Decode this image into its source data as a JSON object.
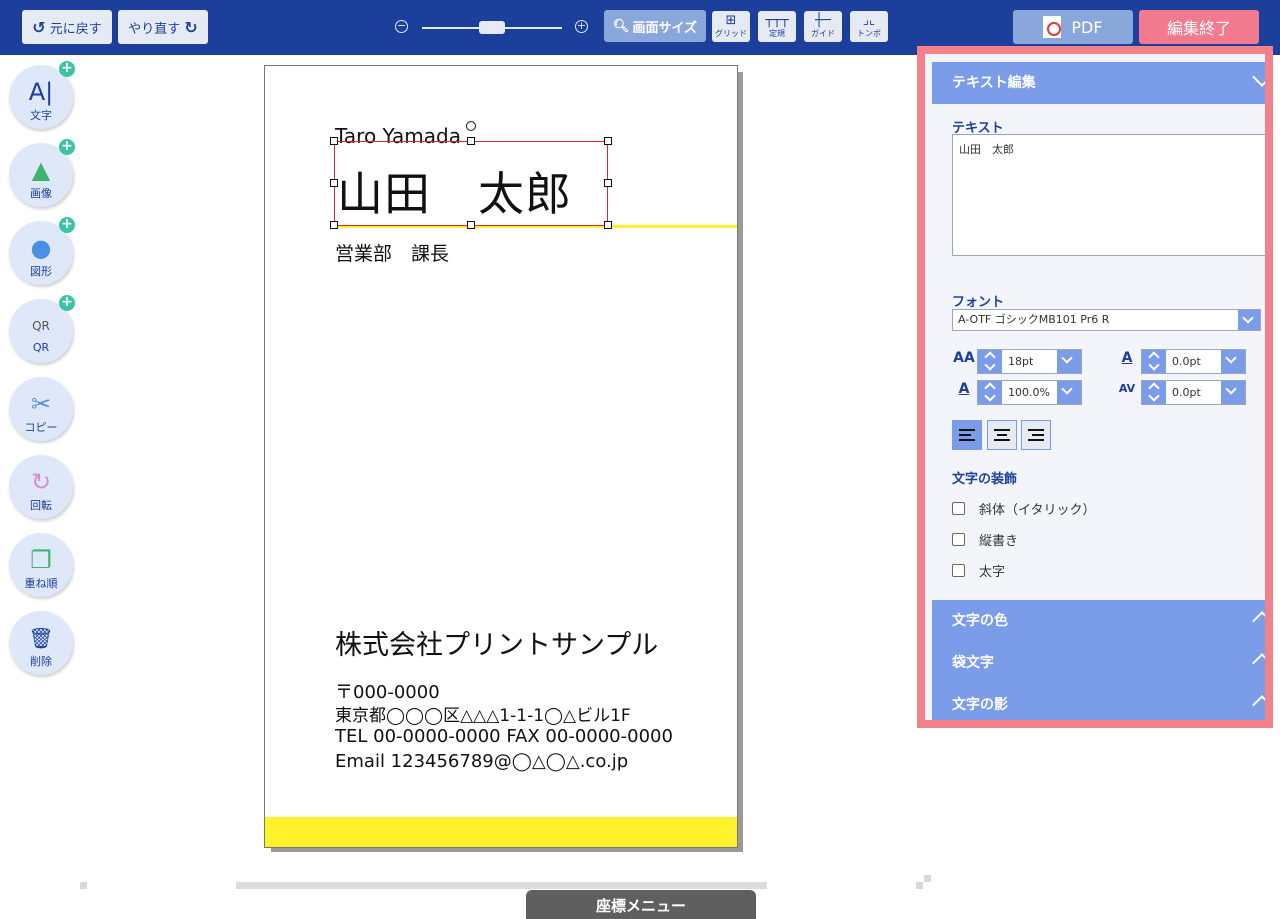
{
  "toolbar": {
    "undo_label": "元に戻す",
    "redo_label": "やり直す",
    "zoom_minus": "−",
    "zoom_plus": "+",
    "zoom_level": 0.5,
    "screen_size_label": "画面サイズ",
    "grid_label": "グリッド",
    "ruler_label": "定規",
    "guide_label": "ガイド",
    "trim_label": "トンボ",
    "pdf_label": "PDF",
    "end_edit_label": "編集終了"
  },
  "left_tools": [
    {
      "glyph": "A|",
      "label": "文字",
      "add": "+"
    },
    {
      "glyph": "▲",
      "label": "画像",
      "add": "+"
    },
    {
      "glyph": "●",
      "label": "図形",
      "add": "+"
    },
    {
      "glyph": "QR",
      "label": "QR",
      "add": "+"
    },
    {
      "glyph": "✂",
      "label": "コピー",
      "add": ""
    },
    {
      "glyph": "↻",
      "label": "回転",
      "add": ""
    },
    {
      "glyph": "❐",
      "label": "重ね順",
      "add": ""
    },
    {
      "glyph": "🗑",
      "label": "削除",
      "add": ""
    }
  ],
  "card": {
    "name_en": "Taro Yamada",
    "name_jp": "山田　太郎",
    "title": "営業部　課長",
    "company": "株式会社プリントサンプル",
    "postal": "〒000-0000",
    "address": "東京都◯◯◯区△△△1-1-1◯△ビル1F",
    "tel_fax": "TEL 00-0000-0000  FAX 00-0000-0000",
    "email": "Email 123456789@◯△◯△.co.jp",
    "accent_color": "#fff22a"
  },
  "coord_menu_label": "座標メニュー",
  "panel": {
    "header": "テキスト編集",
    "text_label": "テキスト",
    "text_value": "山田　太郎",
    "font_label": "フォント",
    "font_value": "A-OTF ゴシックMB101 Pr6 R",
    "font_size_icon": "AA",
    "font_size": "18pt",
    "line_spacing_icon": "A",
    "line_spacing": "0.0pt",
    "width_scale_icon": "A",
    "width_scale": "100.0%",
    "letter_spacing_icon": "AV",
    "letter_spacing": "0.0pt",
    "decoration_label": "文字の装飾",
    "italic_label": "斜体（イタリック）",
    "vertical_label": "縦書き",
    "bold_label": "太字",
    "color_section": "文字の色",
    "outline_section": "袋文字",
    "shadow_section": "文字の影"
  }
}
